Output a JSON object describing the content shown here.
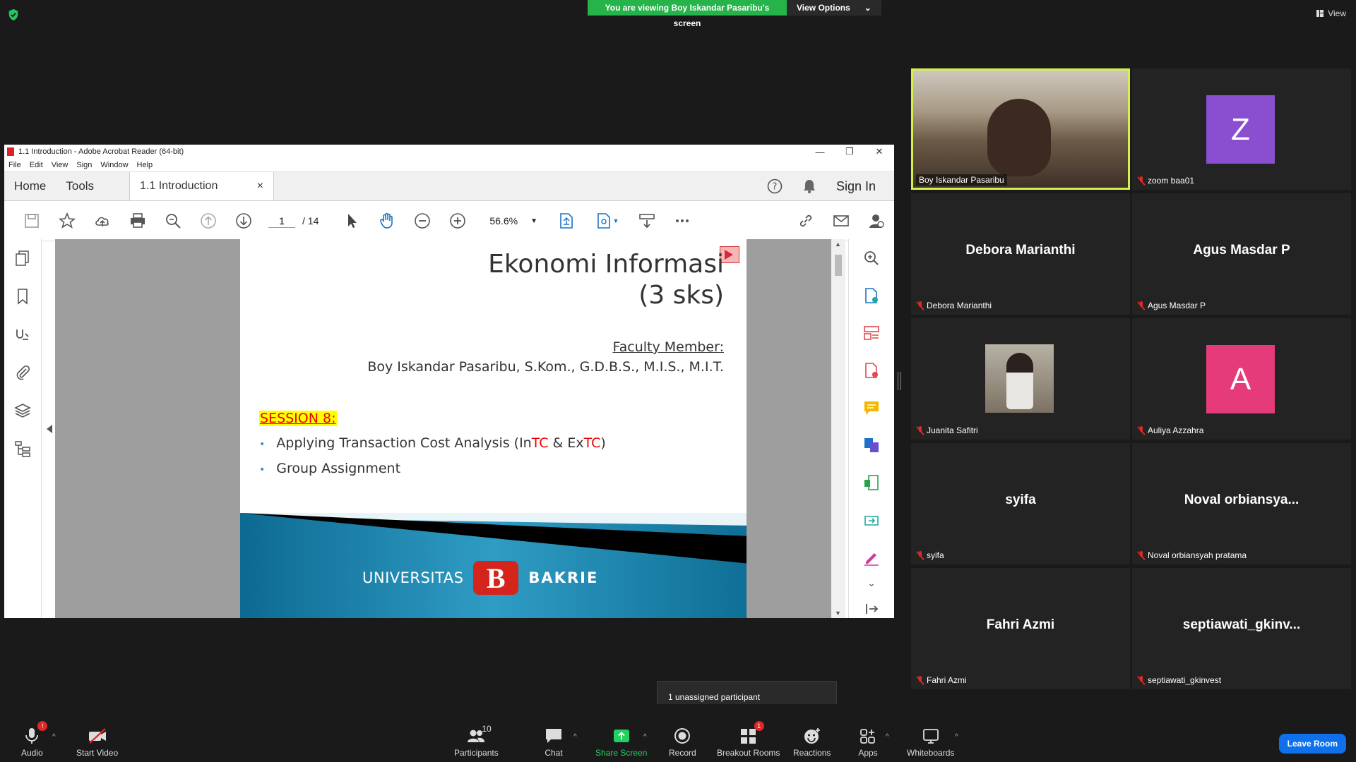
{
  "zoom": {
    "viewing_banner": "You are viewing Boy Iskandar Pasaribu's screen",
    "view_options": "View Options",
    "view_label": "View",
    "tooltip": "1 unassigned participant",
    "leave_label": "Leave Room",
    "toolbar": {
      "audio": "Audio",
      "start_video": "Start Video",
      "participants": "Participants",
      "participants_count": "10",
      "chat": "Chat",
      "share_screen": "Share Screen",
      "record": "Record",
      "breakout_rooms": "Breakout Rooms",
      "breakout_badge": "1",
      "reactions": "Reactions",
      "apps": "Apps",
      "whiteboards": "Whiteboards",
      "audio_badge": "!"
    },
    "participants": [
      {
        "display": "",
        "label": "Boy Iskandar Pasaribu",
        "type": "video"
      },
      {
        "display": "Z",
        "label": "zoom baa01",
        "type": "avatar",
        "color": "#8a4fd1"
      },
      {
        "display": "Debora Marianthi",
        "label": "Debora Marianthi",
        "type": "name"
      },
      {
        "display": "Agus Masdar P",
        "label": "Agus Masdar P",
        "type": "name"
      },
      {
        "display": "",
        "label": "Juanita Safitri",
        "type": "smallvideo"
      },
      {
        "display": "A",
        "label": "Auliya Azzahra",
        "type": "avatar",
        "color": "#e63b7a"
      },
      {
        "display": "syifa",
        "label": "syifa",
        "type": "name"
      },
      {
        "display": "Noval  orbiansya...",
        "label": "Noval orbiansyah pratama",
        "type": "name"
      },
      {
        "display": "Fahri Azmi",
        "label": "Fahri Azmi",
        "type": "name"
      },
      {
        "display": "septiawati_gkinv...",
        "label": "septiawati_gkinvest",
        "type": "name"
      }
    ]
  },
  "acrobat": {
    "window_title": "1.1  Introduction - Adobe Acrobat Reader (64-bit)",
    "menu": [
      "File",
      "Edit",
      "View",
      "Sign",
      "Window",
      "Help"
    ],
    "tabs": {
      "home": "Home",
      "tools": "Tools",
      "doc": "1.1  Introduction",
      "close": "×"
    },
    "sign_in": "Sign In",
    "page_current": "1",
    "page_total": "/  14",
    "zoom_level": "56.6%"
  },
  "slide": {
    "title_line1": "Ekonomi Informasi",
    "title_line2": "(3 sks)",
    "faculty_label": "Faculty Member:",
    "faculty_name": "Boy Iskandar Pasaribu, S.Kom., G.D.B.S., M.I.S., M.I.T.",
    "session": "SESSION 8:",
    "bullet1_a": "Applying Transaction Cost Analysis (In",
    "bullet1_b": "TC",
    "bullet1_c": " & Ex",
    "bullet1_d": "TC",
    "bullet1_e": ")",
    "bullet2": "Group Assignment",
    "logo_left": "UNIVERSITAS",
    "logo_b": "B",
    "logo_right": "BAKRIE",
    "bullet_dot": "•"
  }
}
